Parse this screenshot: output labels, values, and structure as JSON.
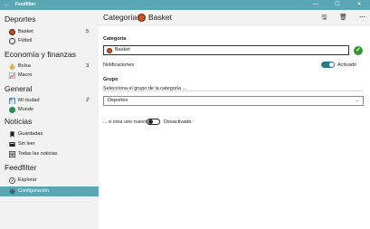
{
  "window": {
    "back_glyph": "←",
    "title": "Feedfilter",
    "minimize_glyph": "—",
    "maximize_glyph": "☐",
    "close_glyph": "✕"
  },
  "sidebar": {
    "sections": [
      {
        "title": "Deportes",
        "items": [
          {
            "label": "Basket",
            "count": "5",
            "icon": "basketball-icon"
          },
          {
            "label": "Fútbol",
            "count": "",
            "icon": "soccer-icon"
          }
        ]
      },
      {
        "title": "Economía y finanzas",
        "items": [
          {
            "label": "Bolsa",
            "count": "3",
            "icon": "money-bag-icon"
          },
          {
            "label": "Macro",
            "count": "",
            "icon": "trend-icon"
          }
        ]
      },
      {
        "title": "General",
        "items": [
          {
            "label": "Mi ciudad",
            "count": "2",
            "icon": "city-icon"
          },
          {
            "label": "Mundo",
            "count": "",
            "icon": "globe-icon"
          }
        ]
      },
      {
        "title": "Noticias",
        "items": [
          {
            "label": "Guardadas",
            "icon": "bookmark-icon"
          },
          {
            "label": "Sin leer",
            "icon": "unread-icon"
          },
          {
            "label": "Todas las noticias",
            "icon": "list-icon"
          }
        ]
      },
      {
        "title": "Feedfilter",
        "items": [
          {
            "label": "Explorar",
            "icon": "compass-icon"
          },
          {
            "label": "Configuración",
            "icon": "gear-icon"
          }
        ]
      }
    ],
    "selected_item": "Configuración",
    "selected_color": "#5aa6b3"
  },
  "main": {
    "title_prefix": "Categoría:",
    "category_name": "Basket",
    "toolbar": {
      "save_glyph": "🖫",
      "delete_glyph": "🗑",
      "more_glyph": "⋯"
    },
    "category_label": "Categoría",
    "name_value": "Basket",
    "ok_glyph": "✓",
    "notifications_label": "Notificaciones",
    "notifications_state": "Activado",
    "group_label": "Grupo",
    "group_hint": "Selecciona el grupo de la categoría ...",
    "group_value": "Deportes",
    "chevron": "⌄",
    "new_group_label": "... o crea uno nuevo",
    "new_group_state": "Desactivado"
  }
}
